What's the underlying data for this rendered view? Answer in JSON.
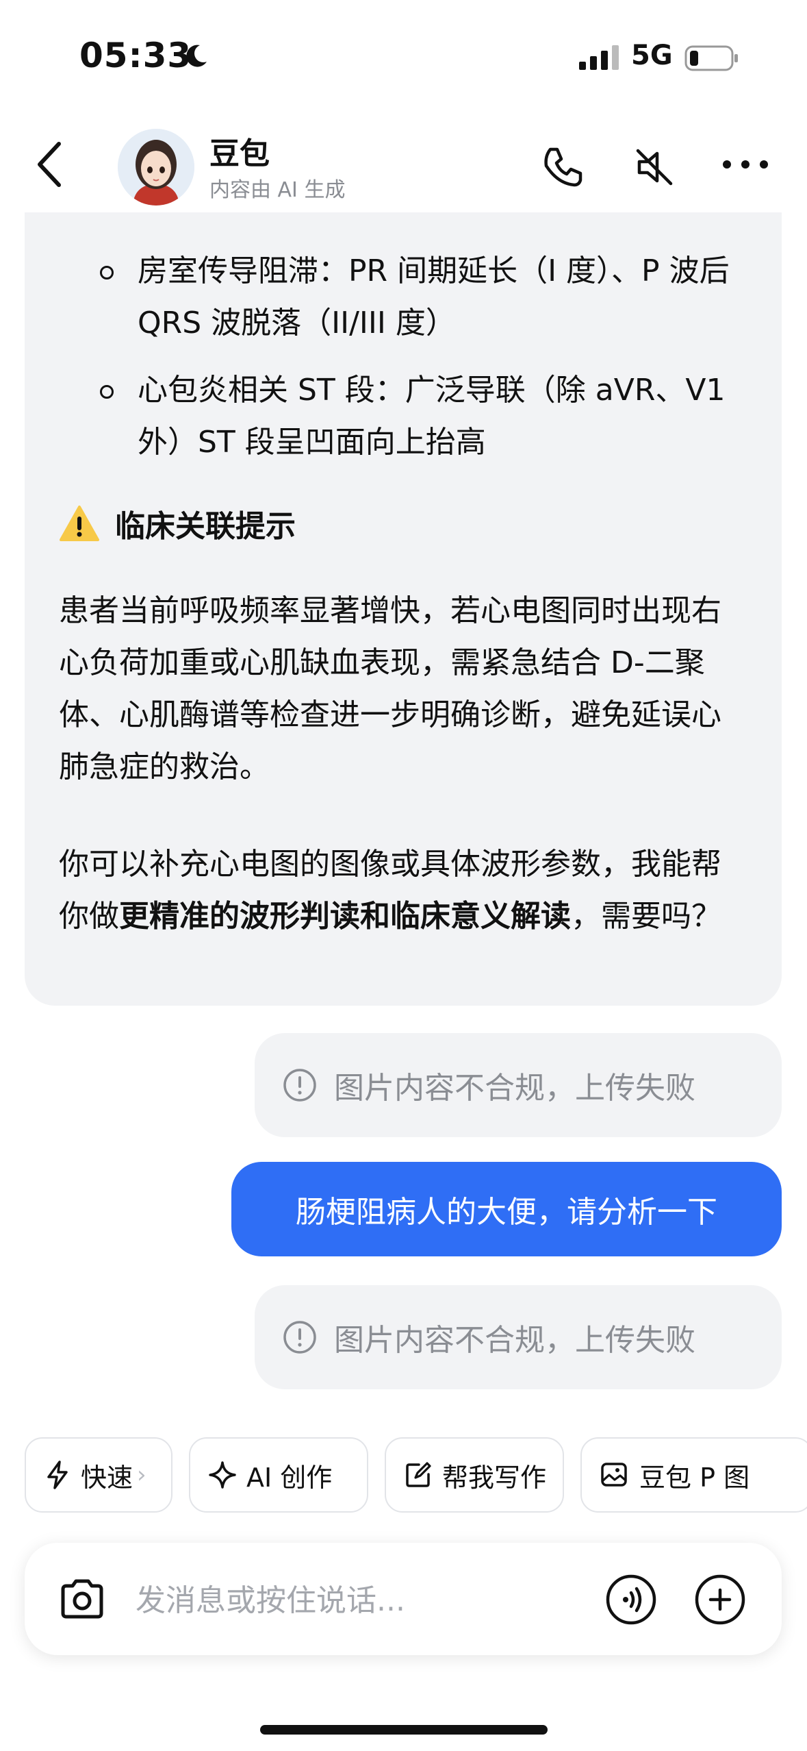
{
  "status_bar": {
    "time": "05:33",
    "network": "5G"
  },
  "header": {
    "name": "豆包",
    "subtitle": "内容由 AI 生成"
  },
  "answer": {
    "bullets": [
      "房室传导阻滞：PR 间期延长（I 度）、P 波后 QRS 波脱落（II/III 度）",
      "心包炎相关 ST 段：广泛导联（除 aVR、V1 外）ST 段呈凹面向上抬高"
    ],
    "warning_title": "临床关联提示",
    "paragraph": "患者当前呼吸频率显著增快，若心电图同时出现右心负荷加重或心肌缺血表现，需紧急结合 D-二聚体、心肌酶谱等检查进一步明确诊断，避免延误心肺急症的救治。",
    "closing_prefix": "你可以补充心电图的图像或具体波形参数，我能帮你做",
    "closing_bold": "更精准的波形判读和临床意义解读",
    "closing_suffix": "，需要吗？"
  },
  "messages": [
    {
      "type": "failed",
      "text": "图片内容不合规，上传失败"
    },
    {
      "type": "user",
      "text": "肠梗阻病人的大便，请分析一下"
    },
    {
      "type": "failed",
      "text": "图片内容不合规，上传失败"
    }
  ],
  "quick_actions": [
    "快速",
    "AI 创作",
    "帮我写作",
    "豆包 P 图"
  ],
  "input": {
    "placeholder": "发消息或按住说话..."
  }
}
